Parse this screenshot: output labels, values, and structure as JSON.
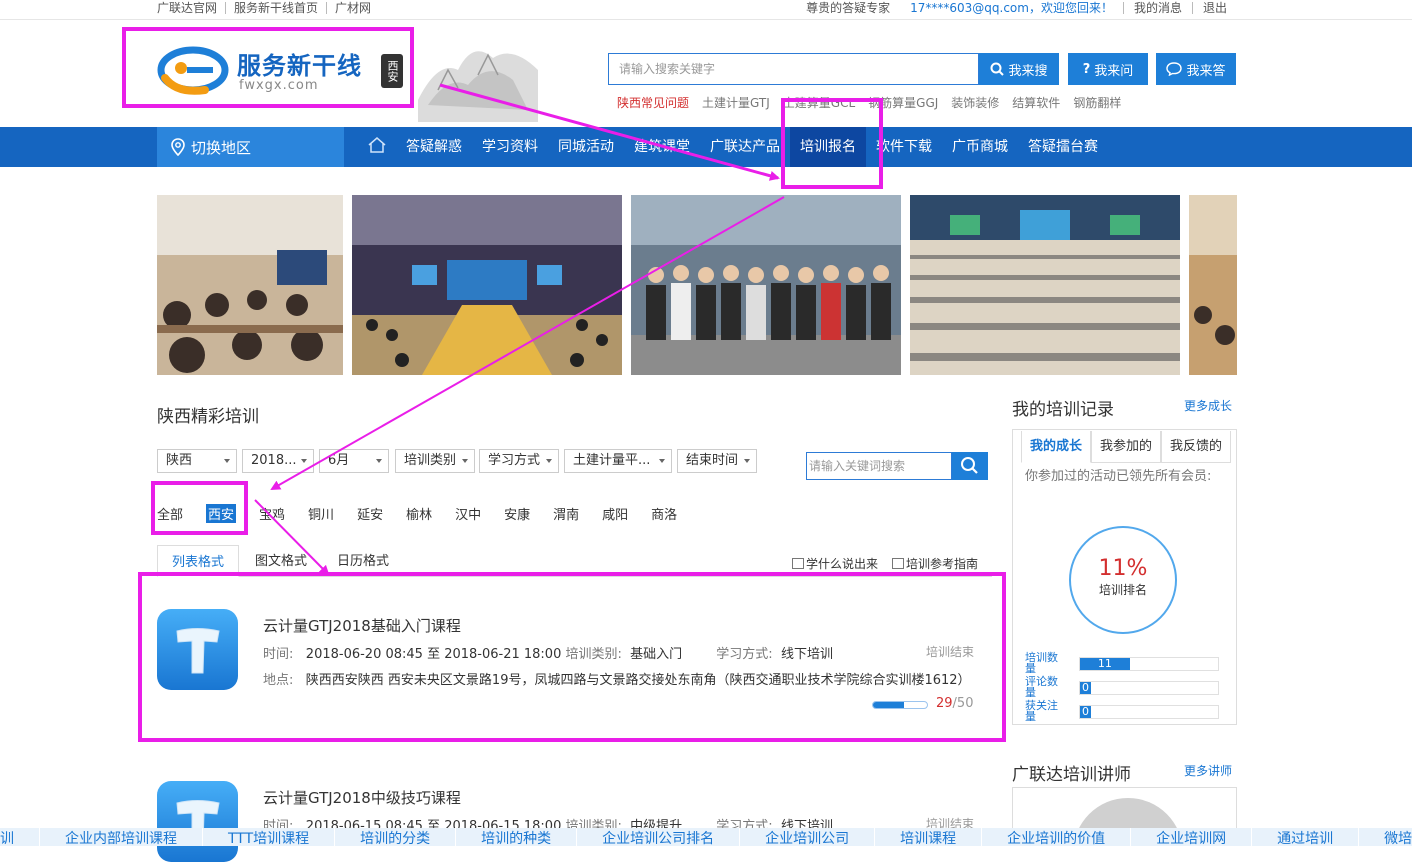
{
  "topbar": {
    "left_links": [
      "广联达官网",
      "服务新干线首页",
      "广材网"
    ],
    "expert": "尊贵的答疑专家",
    "user_greeting": "17****603@qq.com，欢迎您回来！",
    "messages": "我的消息",
    "logout": "退出"
  },
  "logo": {
    "name": "服务新干线",
    "domain": "fwxgx.com",
    "seal": "西安"
  },
  "search": {
    "placeholder": "请输入搜索关键字",
    "btn_search": "我来搜",
    "btn_ask": "我来问",
    "btn_answer": "我来答",
    "hotwords": [
      "陕西常见问题",
      "土建计量GTJ",
      "土建算量GCL",
      "钢筋算量GGJ",
      "装饰装修",
      "结算软件",
      "钢筋翻样"
    ]
  },
  "nav": {
    "region": "切换地区",
    "items": [
      "答疑解惑",
      "学习资料",
      "同城活动",
      "建筑课堂",
      "广联达产品",
      "培训报名",
      "软件下载",
      "广币商城",
      "答疑擂台赛"
    ],
    "active": "培训报名"
  },
  "training": {
    "title": "陕西精彩培训",
    "filters": [
      "陕西",
      "2018...",
      "6月",
      "培训类别",
      "学习方式",
      "土建计量平...",
      "结束时间"
    ],
    "keyword_placeholder": "请输入关键词搜索",
    "cities": [
      "全部",
      "西安",
      "宝鸡",
      "铜川",
      "延安",
      "榆林",
      "汉中",
      "安康",
      "渭南",
      "咸阳",
      "商洛"
    ],
    "selected_city": "西安",
    "tabs": [
      "列表格式",
      "图文格式",
      "日历格式"
    ],
    "tab_links": [
      "学什么说出来",
      "培训参考指南"
    ],
    "courses": [
      {
        "name": "云计量GTJ2018基础入门课程",
        "time_label": "时间:",
        "time": "2018-06-20 08:45 至 2018-06-21 18:00",
        "cat_label": "培训类别:",
        "cat": "基础入门",
        "mode_label": "学习方式:",
        "mode": "线下培训",
        "status": "培训结束",
        "addr_label": "地点:",
        "addr": "陕西西安陕西 西安未央区文景路19号，凤城四路与文景路交接处东南角（陕西交通职业技术学院综合实训楼1612）",
        "enrolled": "29",
        "capacity": "/50",
        "progress": 0.58
      },
      {
        "name": "云计量GTJ2018中级技巧课程",
        "time_label": "时间:",
        "time": "2018-06-15 08:45 至 2018-06-15 18:00",
        "cat_label": "培训类别:",
        "cat": "中级提升",
        "mode_label": "学习方式:",
        "mode": "线下培训",
        "status": "培训结束"
      }
    ]
  },
  "my_records": {
    "title": "我的培训记录",
    "more": "更多成长",
    "tabs": [
      "我的成长",
      "我参加的",
      "我反馈的"
    ],
    "desc": "你参加过的活动已领先所有会员:",
    "percent": "11%",
    "percent_label": "培训排名",
    "stats": [
      {
        "label": "培训数量",
        "value": "11",
        "fraction": 0.36
      },
      {
        "label": "评论数量",
        "value": "0",
        "fraction": 0.08
      },
      {
        "label": "获关注量",
        "value": "0",
        "fraction": 0.08
      }
    ]
  },
  "teachers": {
    "title": "广联达培训讲师",
    "more": "更多讲师"
  },
  "bottom_keywords": [
    "训",
    "企业内部培训课程",
    "TTT培训课程",
    "培训的分类",
    "培训的种类",
    "企业培训公司排名",
    "企业培训公司",
    "培训课程",
    "企业培训的价值",
    "企业培训网",
    "通过培训",
    "微培"
  ],
  "colors": {
    "brand_blue": "#1565c0",
    "accent_blue": "#1e7fd8",
    "annotation_magenta": "#e91ee8",
    "alert_red": "#d32f2f"
  }
}
